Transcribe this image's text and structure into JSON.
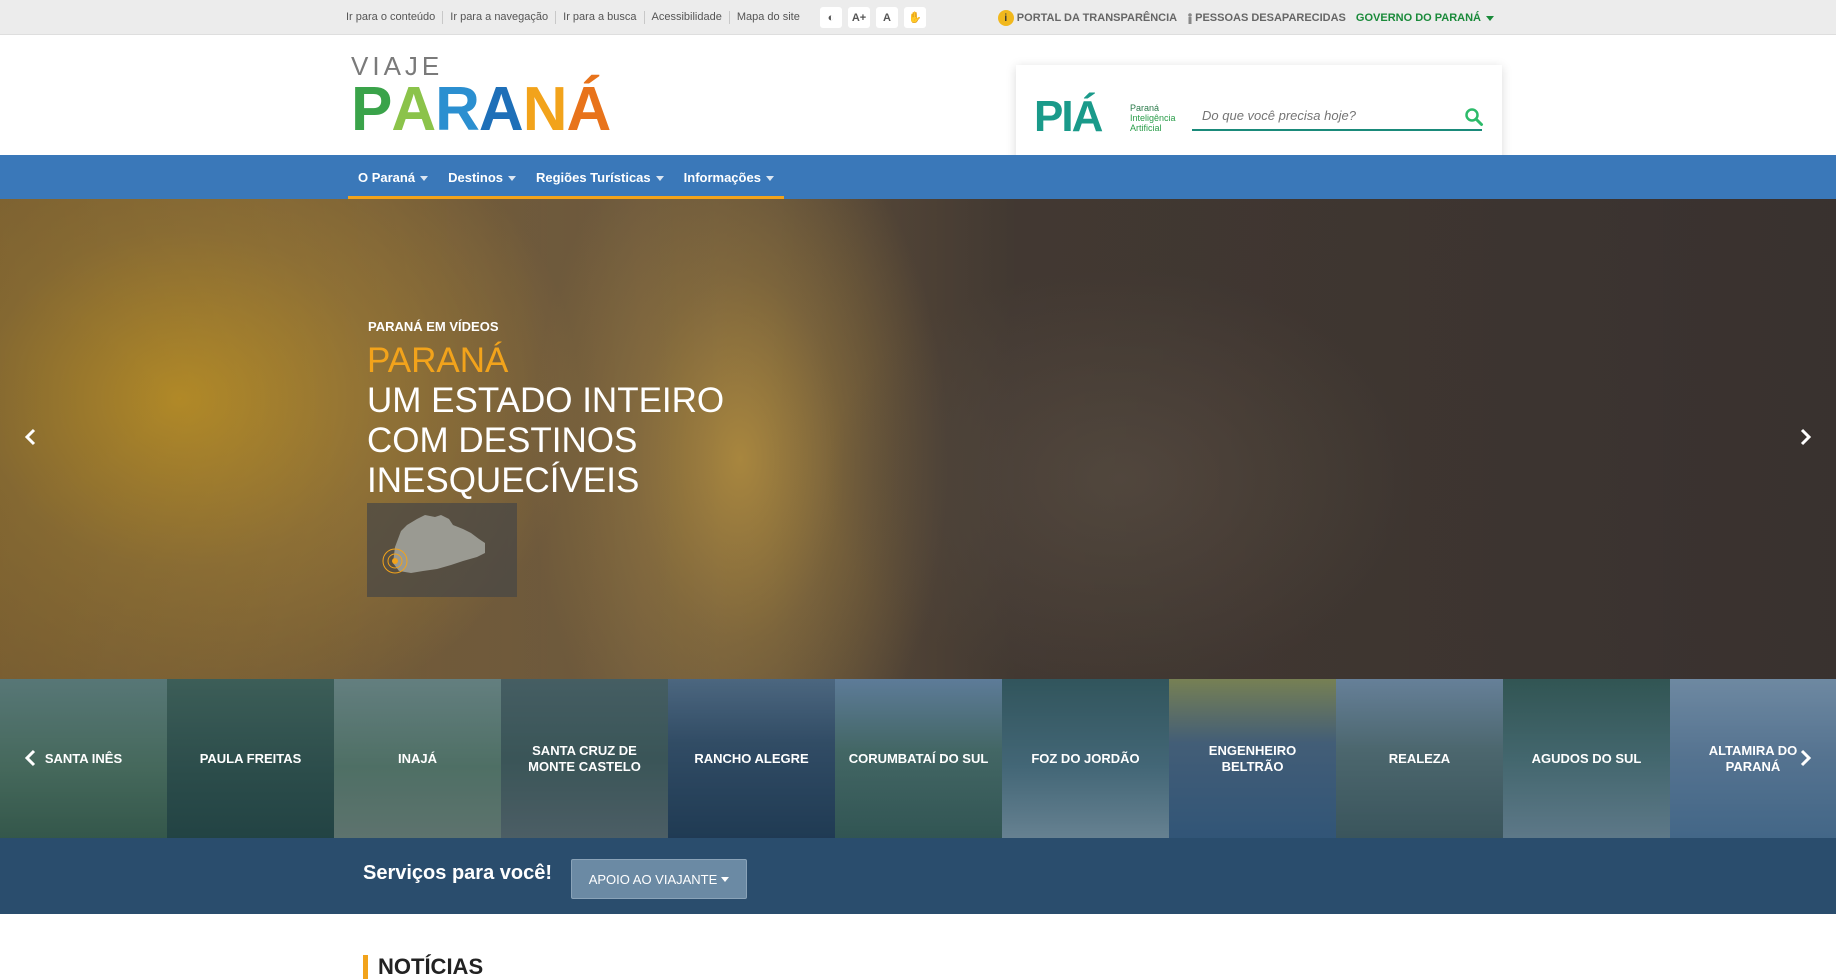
{
  "topbar": {
    "skip_links": [
      "Ir para o conteúdo",
      "Ir para a navegação",
      "Ir para a busca",
      "Acessibilidade",
      "Mapa do site"
    ],
    "tools": {
      "contrast": "◐",
      "font_increase": "A+",
      "font_normal": "A",
      "libras": "✋"
    },
    "portal_transparencia": "PORTAL DA TRANSPARÊNCIA",
    "pessoas_desaparecidas": "PESSOAS DESAPARECIDAS",
    "governo": "GOVERNO DO PARANÁ"
  },
  "header": {
    "logo_top": "VIAJE",
    "logo_letters": [
      "P",
      "A",
      "R",
      "A",
      "N",
      "Á"
    ],
    "pia": "PIÁ",
    "pia_sub": [
      "Paraná",
      "Inteligência",
      "Artificial"
    ],
    "search_placeholder": "Do que você precisa hoje?"
  },
  "nav": {
    "items": [
      "O Paraná",
      "Destinos",
      "Regiões Turísticas",
      "Informações"
    ]
  },
  "hero": {
    "kicker": "PARANÁ EM VÍDEOS",
    "title_highlight": "PARANÁ",
    "title_rest": "UM ESTADO INTEIRO COM DESTINOS INESQUECÍVEIS"
  },
  "destinations": [
    "SANTA INÊS",
    "PAULA FREITAS",
    "INAJÁ",
    "SANTA CRUZ DE MONTE CASTELO",
    "RANCHO ALEGRE",
    "CORUMBATAÍ DO SUL",
    "FOZ DO JORDÃO",
    "ENGENHEIRO BELTRÃO",
    "REALEZA",
    "AGUDOS DO SUL",
    "ALTAMIRA DO PARANÁ"
  ],
  "services": {
    "title": "Serviços para você!",
    "button": "APOIO AO VIAJANTE"
  },
  "news": {
    "title": "NOTÍCIAS"
  },
  "colors": {
    "nav_blue": "#3a78b9",
    "accent_orange": "#f2a31b",
    "services_blue": "#2a4d6d",
    "gov_green": "#1a8a3a"
  }
}
